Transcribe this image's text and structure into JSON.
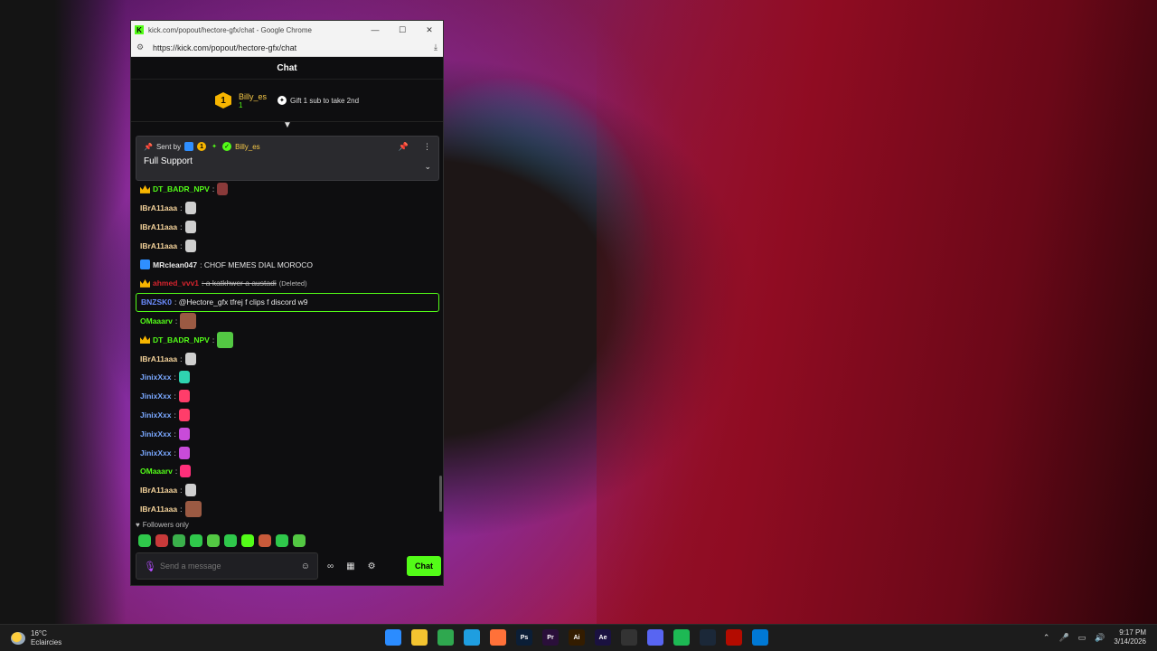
{
  "browser": {
    "tab_title": "kick.com/popout/hectore-gfx/chat - Google Chrome",
    "url": "https://kick.com/popout/hectore-gfx/chat",
    "minimize": "—",
    "maximize": "☐",
    "close": "✕"
  },
  "chat": {
    "header": "Chat",
    "leaderboard": {
      "rank": "1",
      "name": "Billy_es",
      "count": "1",
      "gift_text": "Gift 1 sub to take 2nd"
    },
    "pinned": {
      "sent_by": "Sent by",
      "badge_rank": "1",
      "name": "Billy_es",
      "message": "Full Support"
    },
    "messages": [
      {
        "user": "DT_BADR_NPV",
        "color": "#53fc18",
        "text": ":",
        "crown": true,
        "emote": "#8a3a3a"
      },
      {
        "user": "IBrA11aaa",
        "color": "#f5d39b",
        "text": ":",
        "emote": "#cfcfcf"
      },
      {
        "user": "IBrA11aaa",
        "color": "#f5d39b",
        "text": ":",
        "emote": "#cfcfcf"
      },
      {
        "user": "IBrA11aaa",
        "color": "#f5d39b",
        "text": ":",
        "emote": "#cfcfcf"
      },
      {
        "user": "MRclean047",
        "color": "#e8e8e8",
        "text": ": CHOF MEMES DIAL MOROCO",
        "verified": true
      },
      {
        "user": "ahmed_vvv1",
        "color": "#d6242e",
        "text": ": a katkhwer a austadi",
        "crown": true,
        "deleted_tag": "(Deleted)"
      },
      {
        "user": "BNZSK0",
        "color": "#6b8cff",
        "text": ": @Hectore_gfx tfrej f clips f discord w9"
      },
      {
        "user": "OMaaarv",
        "color": "#53fc18",
        "text": ":",
        "emote": "#9b5a43"
      },
      {
        "user": "DT_BADR_NPV",
        "color": "#53fc18",
        "text": ":",
        "crown": true,
        "emote": "#53c843"
      },
      {
        "user": "IBrA11aaa",
        "color": "#f5d39b",
        "text": ":",
        "emote": "#cfcfcf"
      },
      {
        "user": "JinixXxx",
        "color": "#7aa8ff",
        "text": ":",
        "emote": "#2fd3b0"
      },
      {
        "user": "JinixXxx",
        "color": "#7aa8ff",
        "text": ":",
        "emote": "#ff3d6a"
      },
      {
        "user": "JinixXxx",
        "color": "#7aa8ff",
        "text": ":",
        "emote": "#ff3d6a"
      },
      {
        "user": "JinixXxx",
        "color": "#7aa8ff",
        "text": ":",
        "emote": "#c84bd9"
      },
      {
        "user": "JinixXxx",
        "color": "#7aa8ff",
        "text": ":",
        "emote": "#c84bd9"
      },
      {
        "user": "OMaaarv",
        "color": "#53fc18",
        "text": ":",
        "emote": "#ff2f7a"
      },
      {
        "user": "IBrA11aaa",
        "color": "#f5d39b",
        "text": ":",
        "emote": "#cfcfcf"
      },
      {
        "user": "IBrA11aaa",
        "color": "#f5d39b",
        "text": ":",
        "emote": "#9b5a43"
      }
    ],
    "followers_only": "Followers only",
    "input_placeholder": "Send a message",
    "send_button": "Chat",
    "emote_bar": [
      "#2fc84b",
      "#c83a3a",
      "#3ab04b",
      "#2fc84b",
      "#53c843",
      "#2fc84b",
      "#53fc18",
      "#c85a3a",
      "#2fc84b",
      "#53c843"
    ]
  },
  "taskbar": {
    "weather_temp": "16°C",
    "weather_desc": "Eclaircies",
    "time": "9:17 PM",
    "date": "3/14/2026",
    "apps": [
      {
        "name": "windows-start",
        "label": "",
        "color": "#2b8cff"
      },
      {
        "name": "file-explorer",
        "label": "",
        "color": "#f4c430"
      },
      {
        "name": "chrome",
        "label": "",
        "color": "#2fa84f"
      },
      {
        "name": "edge",
        "label": "",
        "color": "#1f9ee0"
      },
      {
        "name": "firefox",
        "label": "",
        "color": "#ff7139"
      },
      {
        "name": "photoshop",
        "label": "Ps",
        "color": "#0b1e36"
      },
      {
        "name": "premiere",
        "label": "Pr",
        "color": "#2a0f3a"
      },
      {
        "name": "illustrator",
        "label": "Ai",
        "color": "#331c00"
      },
      {
        "name": "after-effects",
        "label": "Ae",
        "color": "#1a1140"
      },
      {
        "name": "obs",
        "label": "",
        "color": "#333"
      },
      {
        "name": "discord",
        "label": "",
        "color": "#5865f2"
      },
      {
        "name": "spotify",
        "label": "",
        "color": "#1db954"
      },
      {
        "name": "steam",
        "label": "",
        "color": "#1b2838"
      },
      {
        "name": "acrobat",
        "label": "",
        "color": "#b30b00"
      },
      {
        "name": "vscode",
        "label": "",
        "color": "#0078d4"
      }
    ]
  }
}
